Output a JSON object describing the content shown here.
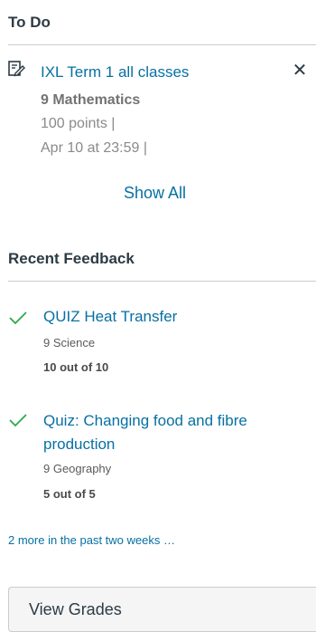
{
  "todo": {
    "heading": "To Do",
    "item": {
      "title": "IXL Term 1 all classes",
      "course": "9 Mathematics",
      "points": "100 points  |",
      "due": "Apr 10 at 23:59  |",
      "icon": "assignment-edit-icon",
      "dismiss_icon": "close-icon",
      "dismiss_glyph": "✕"
    },
    "show_all": "Show All"
  },
  "recent_feedback": {
    "heading": "Recent Feedback",
    "items": [
      {
        "title": "QUIZ Heat Transfer",
        "course": "9 Science",
        "score": "10 out of 10"
      },
      {
        "title_line1": "Quiz: Changing food and fibre",
        "title_line2": "production",
        "course": "9 Geography",
        "score": "5 out of 5"
      }
    ],
    "more_link": "2 more in the past two weeks …",
    "check_color": "#2ea84d"
  },
  "view_grades": "View Grades"
}
